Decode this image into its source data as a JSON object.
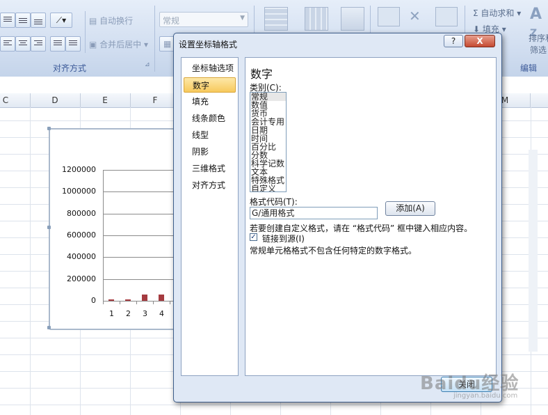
{
  "ribbon": {
    "wrap_text": "自动换行",
    "merge_center": "合并后居中 ▾",
    "alignment_group": "对齐方式",
    "number_format": "常规",
    "autosum": "自动求和 ▾",
    "fill": "填充 ▾",
    "sort_filter_line1": "排序和",
    "sort_filter_line2": "筛选",
    "edit_group": "编辑",
    "sigma_icon": "Σ"
  },
  "columns": [
    "C",
    "D",
    "E",
    "F",
    "M"
  ],
  "chart_data": {
    "type": "bar",
    "categories": [
      "1",
      "2",
      "3",
      "4"
    ],
    "values": [
      8000,
      12000,
      60000,
      55000
    ],
    "yticks": [
      "1200000",
      "1000000",
      "800000",
      "600000",
      "400000",
      "200000",
      "0"
    ],
    "ylim": [
      0,
      1200000
    ],
    "series_color": "#a53b40"
  },
  "dialog": {
    "title": "设置坐标轴格式",
    "help": "?",
    "close_x": "X",
    "nav": [
      "坐标轴选项",
      "数字",
      "填充",
      "线条颜色",
      "线型",
      "阴影",
      "三维格式",
      "对齐方式"
    ],
    "section_title": "数字",
    "category_label": "类别(C):",
    "categories": [
      "常规",
      "数值",
      "货币",
      "会计专用",
      "日期",
      "时间",
      "百分比",
      "分数",
      "科学记数",
      "文本",
      "特殊格式",
      "自定义"
    ],
    "format_code_label": "格式代码(T):",
    "format_code_value": "G/通用格式",
    "add_button": "添加(A)",
    "hint": "若要创建自定义格式，请在 “格式代码” 框中键入相应内容。",
    "link_source": "链接到源(I)",
    "check_mark": "✓",
    "description": "常规单元格格式不包含任何特定的数字格式。",
    "close_button": "关闭"
  },
  "watermark": "Baidu经验",
  "watermark_sub": "jingyan.baidu.com"
}
